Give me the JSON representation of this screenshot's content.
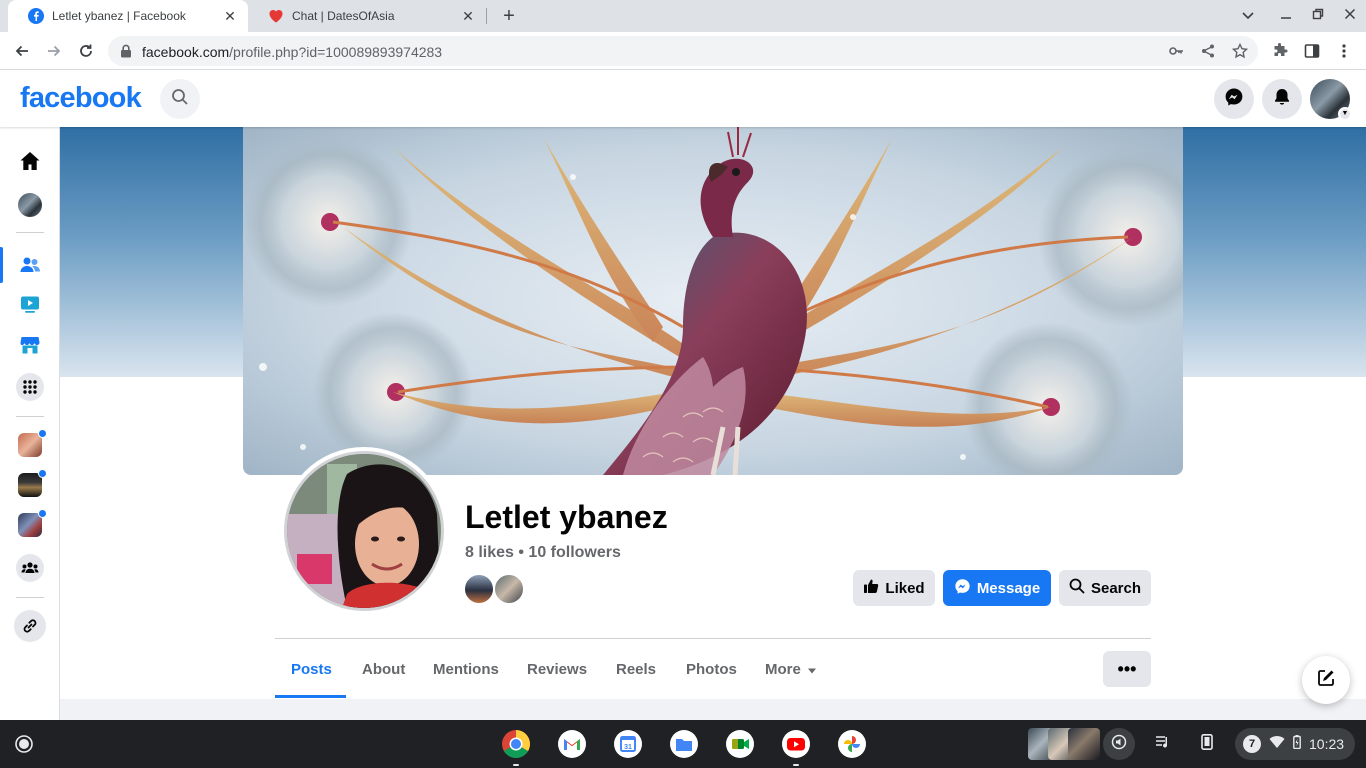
{
  "browser": {
    "tabs": [
      {
        "title": "Letlet ybanez | Facebook",
        "active": true,
        "favicon": "facebook-icon"
      },
      {
        "title": "Chat | DatesOfAsia",
        "active": false,
        "favicon": "heart-icon"
      }
    ],
    "url_host": "facebook.com",
    "url_path": "/profile.php?id=100089893974283"
  },
  "facebook": {
    "logo": "facebook",
    "colors": {
      "brand": "#1877f2",
      "secondary_text": "#65676b"
    }
  },
  "profile": {
    "name": "Letlet ybanez",
    "stats": "8 likes • 10 followers",
    "buttons": {
      "liked": "Liked",
      "message": "Message",
      "search": "Search"
    },
    "tabs": [
      "Posts",
      "About",
      "Mentions",
      "Reviews",
      "Reels",
      "Photos",
      "More"
    ],
    "more_menu": "•••"
  },
  "shelf": {
    "notification_count": "7",
    "time": "10:23"
  }
}
